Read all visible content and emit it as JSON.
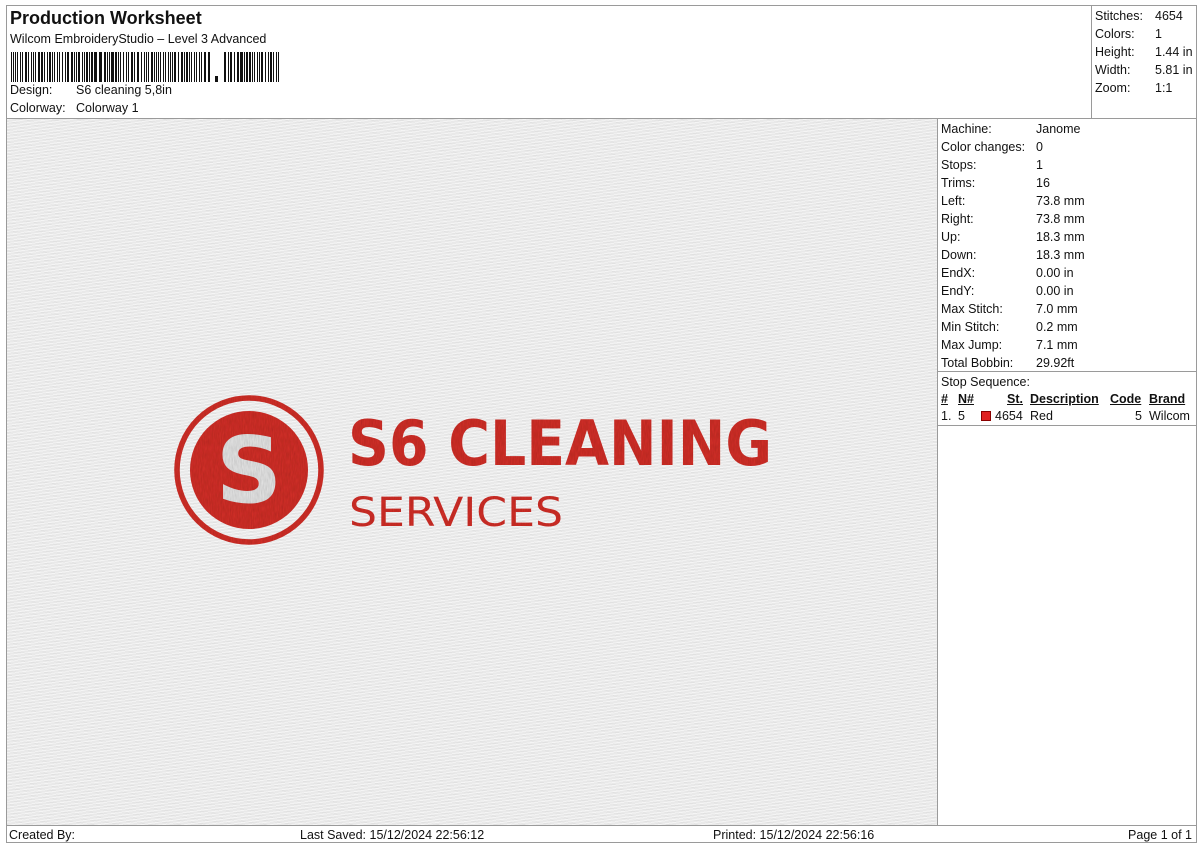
{
  "header": {
    "title": "Production Worksheet",
    "subtitle": "Wilcom EmbroideryStudio – Level 3 Advanced",
    "design_label": "Design:",
    "design_value": "S6 cleaning 5,8in",
    "colorway_label": "Colorway:",
    "colorway_value": "Colorway 1"
  },
  "summary": {
    "items": [
      {
        "label": "Stitches:",
        "value": "4654"
      },
      {
        "label": "Colors:",
        "value": "1"
      },
      {
        "label": "Height:",
        "value": "1.44 in"
      },
      {
        "label": "Width:",
        "value": "5.81 in"
      },
      {
        "label": "Zoom:",
        "value": "1:1"
      }
    ]
  },
  "machine": {
    "items": [
      {
        "label": "Machine:",
        "value": "Janome"
      },
      {
        "label": "Color changes:",
        "value": "0"
      },
      {
        "label": "Stops:",
        "value": "1"
      },
      {
        "label": "Trims:",
        "value": "16"
      },
      {
        "label": "Left:",
        "value": "73.8 mm"
      },
      {
        "label": "Right:",
        "value": "73.8 mm"
      },
      {
        "label": "Up:",
        "value": "18.3 mm"
      },
      {
        "label": "Down:",
        "value": "18.3 mm"
      },
      {
        "label": "EndX:",
        "value": "0.00 in"
      },
      {
        "label": "EndY:",
        "value": "0.00 in"
      },
      {
        "label": "Max Stitch:",
        "value": "7.0 mm"
      },
      {
        "label": "Min Stitch:",
        "value": "0.2 mm"
      },
      {
        "label": "Max Jump:",
        "value": "7.1 mm"
      },
      {
        "label": "Total Bobbin:",
        "value": "29.92ft"
      }
    ]
  },
  "stop_sequence": {
    "title": "Stop Sequence:",
    "columns": [
      "#",
      "N#",
      "St.",
      "Description",
      "Code",
      "Brand"
    ],
    "rows": [
      {
        "index": "1.",
        "needle": "5",
        "color": "#e02020",
        "stitches": "4654",
        "description": "Red",
        "code": "5",
        "brand": "Wilcom"
      }
    ]
  },
  "design": {
    "monogram": "S",
    "line1": "S6 CLEANING",
    "line2": "SERVICES",
    "thread_color": "#d6302c"
  },
  "footer": {
    "created_by": "Created By:",
    "last_saved": "Last Saved: 15/12/2024 22:56:12",
    "printed": "Printed: 15/12/2024 22:56:16",
    "page": "Page 1 of 1"
  }
}
